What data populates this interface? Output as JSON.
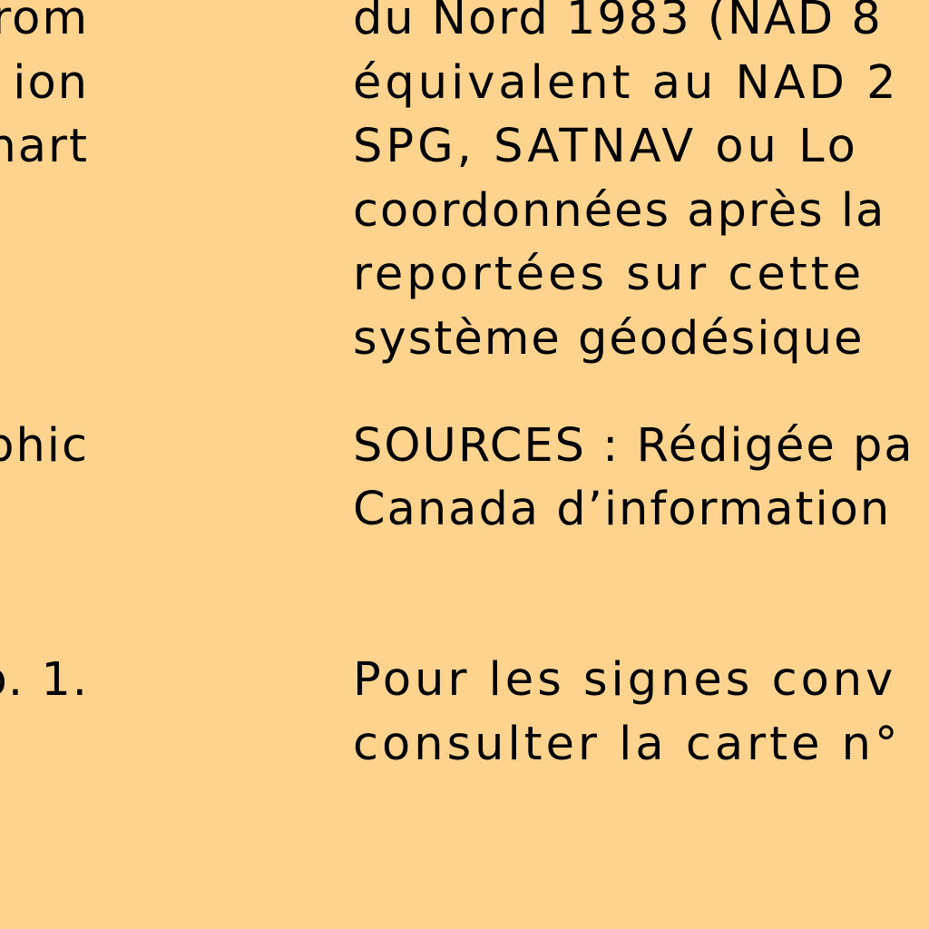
{
  "background_color": "#fed38e",
  "text_color": "#000000",
  "left_column": [
    "rom",
    "ion",
    "nart",
    "phic",
    "o. 1."
  ],
  "right_column": {
    "datum_note": [
      "du Nord 1983 (NAD 8",
      "équivalent au NAD 2",
      "SPG, SATNAV ou Lo",
      "coordonnées après la",
      "reportées sur cette",
      "système géodésique"
    ],
    "sources_note": [
      "SOURCES : Rédigée pa",
      "Canada d’information"
    ],
    "symbols_note": [
      "Pour les signes conv",
      "consulter la carte n°"
    ]
  }
}
